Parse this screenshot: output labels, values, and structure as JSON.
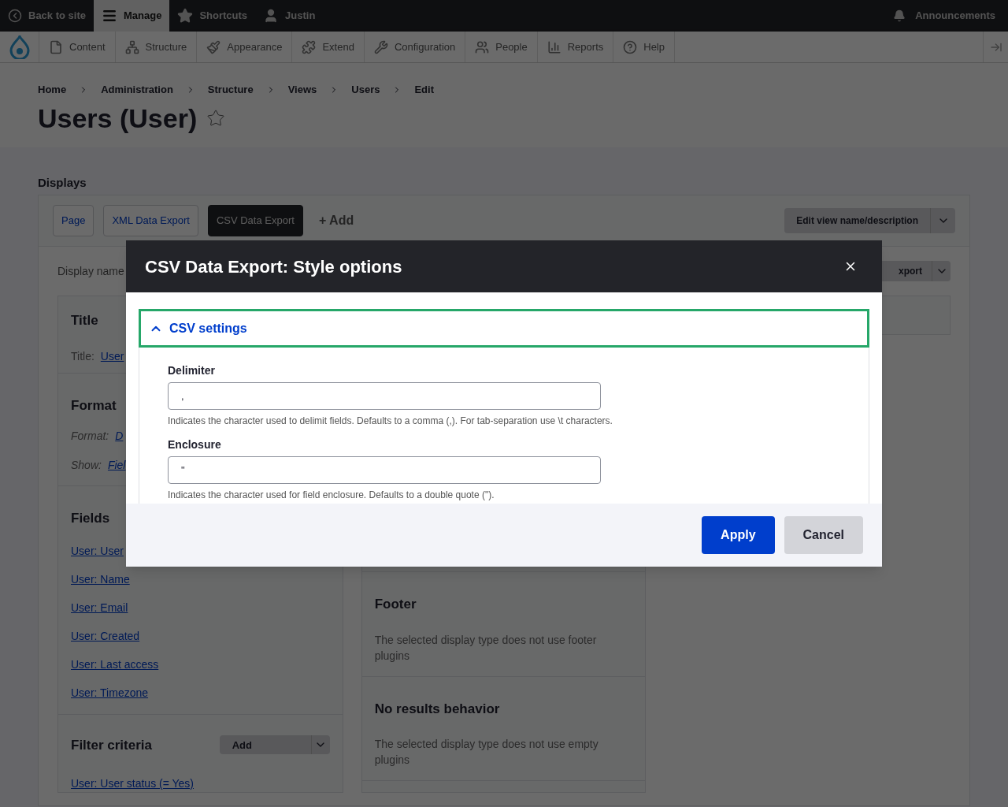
{
  "toolbar": {
    "back": "Back to site",
    "tabs": [
      {
        "label": "Manage",
        "selected": true,
        "kind": "menu"
      },
      {
        "label": "Shortcuts",
        "selected": false,
        "kind": "star"
      },
      {
        "label": "Justin",
        "selected": false,
        "kind": "user"
      }
    ],
    "announcements": "Announcements"
  },
  "admin_menu": [
    {
      "label": "Content",
      "kind": "file"
    },
    {
      "label": "Structure",
      "kind": "structure"
    },
    {
      "label": "Appearance",
      "kind": "brush"
    },
    {
      "label": "Extend",
      "kind": "puzzle"
    },
    {
      "label": "Configuration",
      "kind": "wrench"
    },
    {
      "label": "People",
      "kind": "people"
    },
    {
      "label": "Reports",
      "kind": "chart"
    },
    {
      "label": "Help",
      "kind": "help"
    }
  ],
  "breadcrumb": [
    "Home",
    "Administration",
    "Structure",
    "Views",
    "Users",
    "Edit"
  ],
  "page_title": "Users (User)",
  "starred": false,
  "displays": {
    "heading": "Displays",
    "tabs": [
      {
        "label": "Page",
        "selected": false
      },
      {
        "label": "XML Data Export",
        "selected": false
      },
      {
        "label": "CSV Data Export",
        "selected": true
      }
    ],
    "add": "+ Add",
    "edit_button": "Edit view name/description"
  },
  "display_name": {
    "label": "Display name",
    "menu": "xport"
  },
  "left_column": {
    "title": {
      "heading": "Title",
      "label": "Title:",
      "link": "User"
    },
    "format": {
      "heading": "Format",
      "rows": [
        {
          "label": "Format:",
          "link": "D"
        },
        {
          "label": "Show:",
          "link": "Fiel"
        }
      ]
    },
    "fields": {
      "heading": "Fields",
      "items": [
        "User: User",
        "User: Name",
        "User: Email",
        "User: Created",
        "User: Last access",
        "User: Timezone"
      ]
    },
    "filter": {
      "heading": "Filter criteria",
      "add_button": "Add",
      "items": [
        "User: User status (= Yes)"
      ]
    }
  },
  "middle_column": [
    {
      "heading": "Footer",
      "text": "The selected display type does not use footer plugins"
    },
    {
      "heading": "No results behavior",
      "text": "The selected display type does not use empty plugins"
    }
  ],
  "modal": {
    "title": "CSV Data Export: Style options",
    "details": {
      "summary": "CSV settings",
      "expanded": true
    },
    "fields": [
      {
        "label": "Delimiter",
        "value": ",",
        "description": "Indicates the character used to delimit fields. Defaults to a comma (,). For tab-separation use \\t characters."
      },
      {
        "label": "Enclosure",
        "value": "\"",
        "description": "Indicates the character used for field enclosure. Defaults to a double quote (\")."
      }
    ],
    "buttons": [
      {
        "label": "Apply",
        "kind": "primary"
      },
      {
        "label": "Cancel",
        "kind": "secondary"
      }
    ]
  }
}
